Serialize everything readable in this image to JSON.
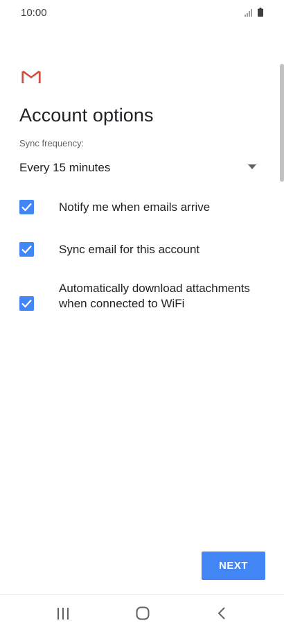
{
  "status_bar": {
    "time": "10:00",
    "signal_icon": "signal-icon",
    "battery_icon": "battery-icon"
  },
  "logo_icon": "gmail-icon",
  "title": "Account options",
  "sync": {
    "label": "Sync frequency:",
    "value": "Every 15 minutes",
    "icon": "dropdown-arrow-icon"
  },
  "options": [
    {
      "label": "Notify me when emails arrive",
      "checked": true
    },
    {
      "label": "Sync email for this account",
      "checked": true
    },
    {
      "label": "Automatically download attachments when connected to WiFi",
      "checked": true
    }
  ],
  "next_label": "NEXT",
  "nav": {
    "recents_icon": "recents-icon",
    "home_icon": "home-icon",
    "back_icon": "back-icon"
  },
  "colors": {
    "accent": "#4285f4",
    "gmail_red": "#d44638",
    "text_primary": "#202124",
    "text_secondary": "#5f6368"
  }
}
